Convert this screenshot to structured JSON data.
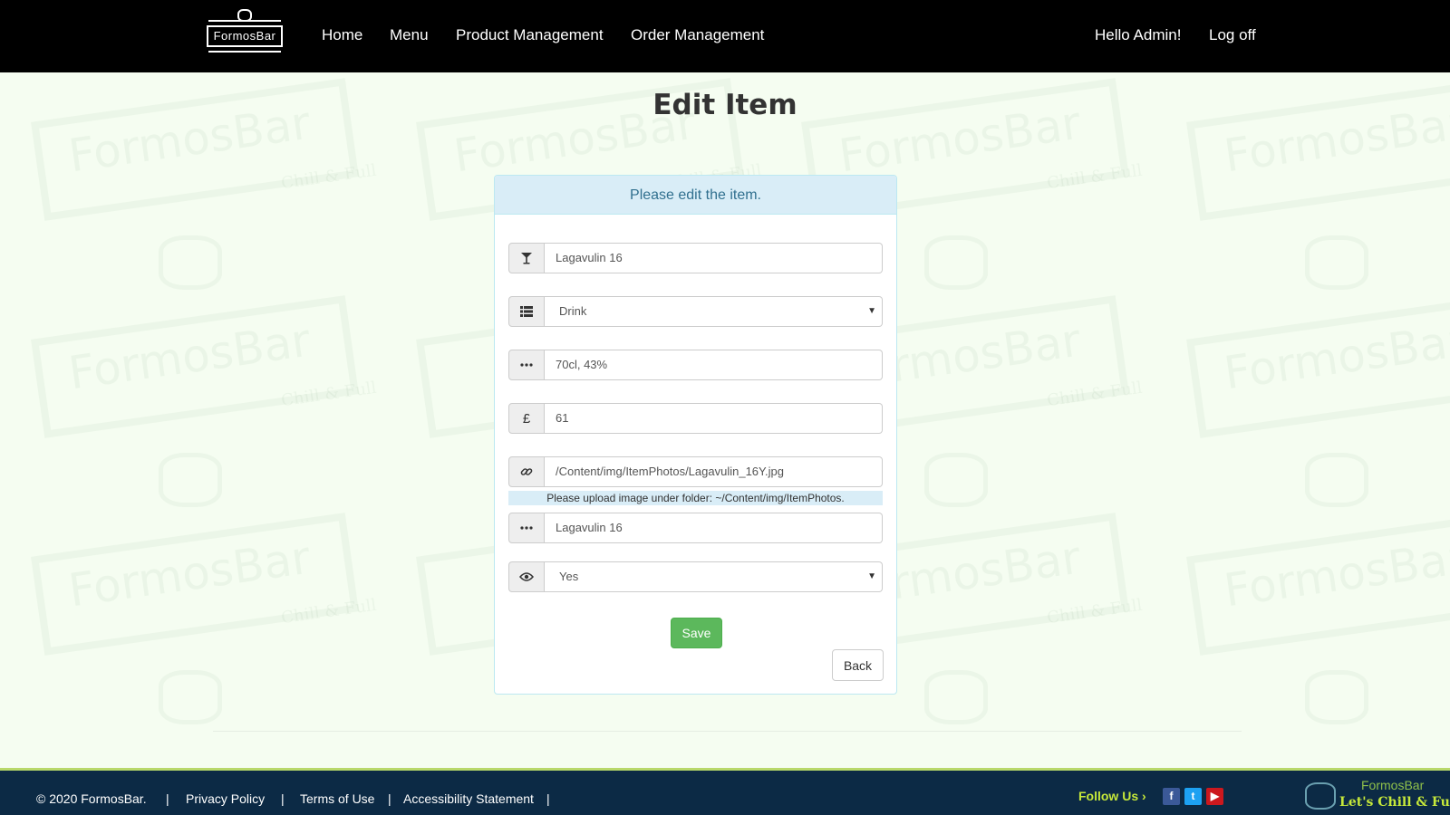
{
  "nav": {
    "brand": "FormosBar",
    "links": [
      "Home",
      "Menu",
      "Product Management",
      "Order Management"
    ],
    "greeting": "Hello Admin!",
    "logoff": "Log off"
  },
  "page": {
    "title": "Edit Item",
    "panel_heading": "Please edit the item."
  },
  "form": {
    "name": "Lagavulin 16",
    "category": "Drink",
    "description": "70cl, 43%",
    "price": "61",
    "image_path": "/Content/img/ItemPhotos/Lagavulin_16Y.jpg",
    "image_hint": "Please upload image under folder: ~/Content/img/ItemPhotos.",
    "alt_text": "Lagavulin 16",
    "visible": "Yes",
    "save_label": "Save",
    "back_label": "Back"
  },
  "icons": {
    "name": "cocktail-icon",
    "category": "list-icon",
    "description": "ellipsis-icon",
    "price": "pound-icon",
    "image": "link-icon",
    "alt": "ellipsis-icon",
    "visible": "eye-icon"
  },
  "watermark": {
    "text": "FormosBar",
    "sub": "Chill & Full"
  },
  "footer": {
    "copyright": "© 2020 FormosBar.",
    "separator": "|",
    "links": [
      "Privacy Policy",
      "Terms of Use",
      "Accessibility Statement"
    ],
    "follow": "Follow Us",
    "brand_top": "FormosBar",
    "brand_tagline": "Let's Chill & Full"
  },
  "colors": {
    "accent_green": "#5cb85c",
    "heading_blue": "#d9edf7",
    "footer_bg": "#0c2a45",
    "footer_accent": "#c6e83a"
  }
}
